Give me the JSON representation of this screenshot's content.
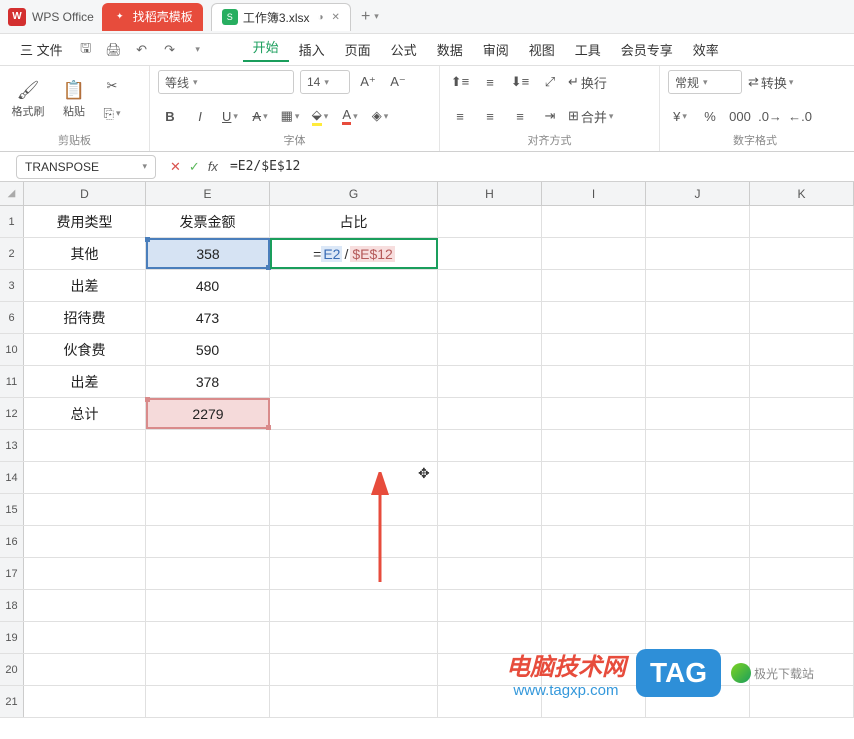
{
  "app": {
    "name": "WPS Office"
  },
  "tabs": [
    {
      "label": "找稻壳模板"
    },
    {
      "label": "工作簿3.xlsx"
    }
  ],
  "menu": {
    "file": "三 文件",
    "items": [
      "开始",
      "插入",
      "页面",
      "公式",
      "数据",
      "审阅",
      "视图",
      "工具",
      "会员专享",
      "效率"
    ]
  },
  "toolbar": {
    "clipboard": {
      "format_painter": "格式刷",
      "paste": "粘贴",
      "group": "剪贴板"
    },
    "font": {
      "name": "等线",
      "size": "14",
      "group": "字体"
    },
    "align": {
      "wrap": "换行",
      "merge": "合并",
      "group": "对齐方式"
    },
    "number": {
      "format": "常规",
      "convert": "转换",
      "group": "数字格式"
    }
  },
  "namebox": "TRANSPOSE",
  "formula": "=E2/$E$12",
  "columns": [
    "D",
    "E",
    "G",
    "H",
    "I",
    "J",
    "K"
  ],
  "rows": [
    {
      "n": "1",
      "d": "费用类型",
      "e": "发票金额",
      "g": "占比",
      "header": true
    },
    {
      "n": "2",
      "d": "其他",
      "e": "358",
      "g_formula": {
        "ref1": "E2",
        "ref2": "$E$12"
      }
    },
    {
      "n": "3",
      "d": "出差",
      "e": "480"
    },
    {
      "n": "6",
      "d": "招待费",
      "e": "473"
    },
    {
      "n": "10",
      "d": "伙食费",
      "e": "590"
    },
    {
      "n": "11",
      "d": "出差",
      "e": "378"
    },
    {
      "n": "12",
      "d": "总计",
      "e": "2279"
    },
    {
      "n": "13"
    },
    {
      "n": "14"
    },
    {
      "n": "15"
    },
    {
      "n": "16"
    },
    {
      "n": "17"
    },
    {
      "n": "18"
    },
    {
      "n": "19"
    },
    {
      "n": "20"
    },
    {
      "n": "21"
    }
  ],
  "watermark": {
    "line1": "电脑技术网",
    "line2": "www.tagxp.com",
    "tag": "TAG",
    "jg": "极光下载站"
  }
}
